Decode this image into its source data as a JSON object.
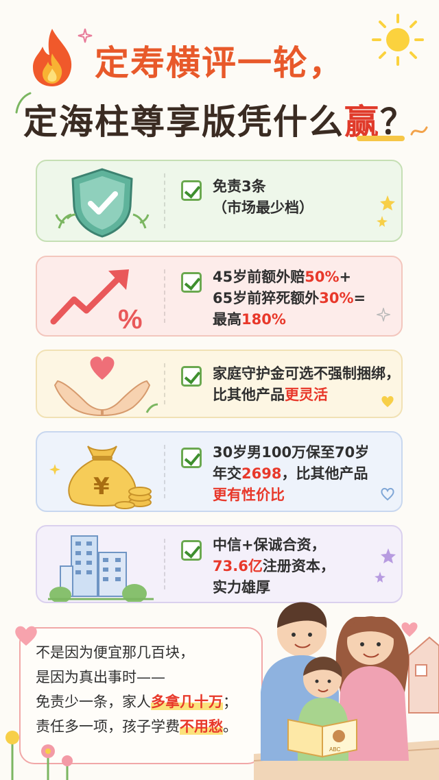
{
  "title": {
    "line1": "定寿横评一轮，",
    "line2_main": "定海柱尊享版凭什么",
    "line2_highlight": "赢",
    "line2_end": "？"
  },
  "cards": [
    {
      "line1": "免责3条",
      "line2": "（市场最少档）"
    },
    {
      "line1_a": "45岁前额外赔",
      "line1_red": "50%",
      "line1_b": "+",
      "line2_a": "65岁前猝死额外",
      "line2_red": "30%",
      "line2_b": "=",
      "line3_a": "最高",
      "line3_red": "180%"
    },
    {
      "line1": "家庭守护金可选不强制捆绑，",
      "line2_a": "比其他产品",
      "line2_red": "更灵活"
    },
    {
      "line1": "30岁男100万保至70岁",
      "line2_a": "年交",
      "line2_red": "2698",
      "line2_b": "，比其他产品",
      "line3_red": "更有性价比"
    },
    {
      "line1": "中信+保诚合资，",
      "line2_red": "73.6亿",
      "line2_b": "注册资本，",
      "line3": "实力雄厚"
    }
  ],
  "note": {
    "line1": "不是因为便宜那几百块，",
    "line2": "是因为真出事时——",
    "line3_a": "免责少一条，家人",
    "line3_red": "多拿几十万",
    "line3_b": "；",
    "line4_a": "责任多一项，孩子学费",
    "line4_red": "不用愁",
    "line4_b": "。"
  },
  "book_cover_text": "ABC",
  "colors": {
    "title_orange": "#e8592a",
    "accent_red": "#e8382a",
    "check_green": "#3e8f2e"
  }
}
